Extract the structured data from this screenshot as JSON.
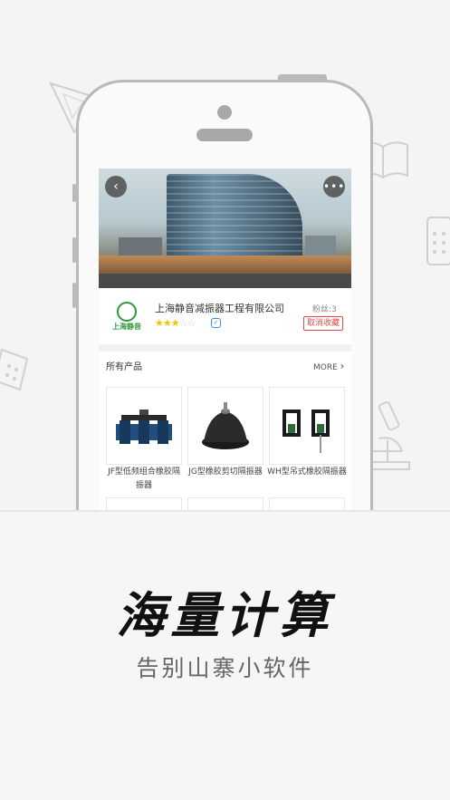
{
  "screen": {
    "back_icon": "chevron-left-icon",
    "more_icon": "ellipsis-icon",
    "company": {
      "name": "上海静音减振器工程有限公司",
      "logo_text": "上海静音",
      "rating": 3,
      "rating_max": 5,
      "fans_label": "粉丝:3",
      "unfollow_label": "取消收藏"
    },
    "products_section": {
      "title": "所有产品",
      "more_label": "MORE",
      "items": [
        {
          "name": "JF型低频组合橡胶隔振器"
        },
        {
          "name": "JG型橡胶剪切隔振器"
        },
        {
          "name": "WH型吊式橡胶隔振器"
        }
      ]
    }
  },
  "headline": "海量计算",
  "subline": "告别山寨小软件",
  "colors": {
    "accent_red": "#e04a4a",
    "logo_green": "#2f9a3a",
    "star_yellow": "#f5c400",
    "frame_gray": "#b9b9b9"
  }
}
